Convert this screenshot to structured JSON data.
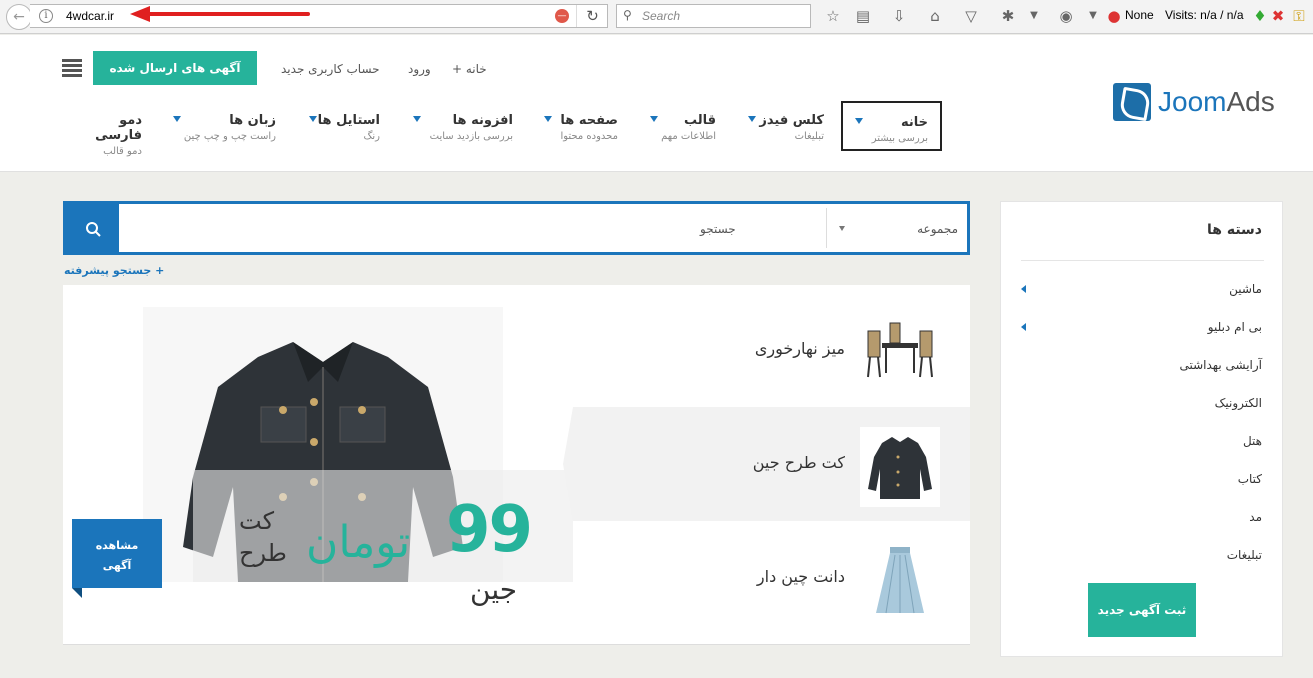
{
  "browser": {
    "url": "4wdcar.ir",
    "search_placeholder": "Search",
    "status_none": "None",
    "visits_text": "Visits: n/a / n/a"
  },
  "header": {
    "logo": {
      "part1": "Joom",
      "part2": "Ads"
    },
    "top_links": {
      "home": "خانه +",
      "login": "ورود",
      "new_account": "حساب کاربری جدید"
    },
    "post_button": "آگهی های ارسال شده",
    "menu": [
      {
        "label": "خانه",
        "sub": "بررسی بیشتر"
      },
      {
        "label": "کلس فیدز",
        "sub": "تبلیغات"
      },
      {
        "label": "قالب",
        "sub": "اطلاعات مهم"
      },
      {
        "label": "صفحه ها",
        "sub": "محدوده محتوا"
      },
      {
        "label": "افزونه ها",
        "sub": "بررسی بازدید سایت"
      },
      {
        "label": "استایل ها",
        "sub": "رنگ"
      },
      {
        "label": "زبان ها",
        "sub": "راست چپ و چپ چین"
      },
      {
        "label": "دمو فارسی",
        "sub": "دمو قالب"
      }
    ]
  },
  "search": {
    "placeholder": "جستجو",
    "category_label": "مجموعه",
    "advanced_link": "+ جستجو پیشرفته"
  },
  "slider": {
    "price": "99",
    "unit": "تومان",
    "name_line1": "کت",
    "name_line2": "طرح",
    "name_line3": "جین",
    "view_button_line1": "مشاهده",
    "view_button_line2": "آگهی",
    "thumbs": [
      {
        "label": "میز نهارخوری",
        "icon": "dining-table"
      },
      {
        "label": "کت طرح جین",
        "icon": "denim-jacket"
      },
      {
        "label": "دانت چین دار",
        "icon": "pleated-skirt"
      }
    ]
  },
  "sidebar": {
    "title": "دسته ها",
    "categories": [
      "ماشین",
      "بی ام دبلیو",
      "آرایشی بهداشتی",
      "الکترونیک",
      "هتل",
      "کتاب",
      "مد",
      "تبلیغات"
    ],
    "new_ad_button": "ثبت آگهی جدید"
  },
  "colors": {
    "accent_blue": "#1b75bb",
    "accent_green": "#26b39b",
    "annotation_red": "#e02020"
  }
}
